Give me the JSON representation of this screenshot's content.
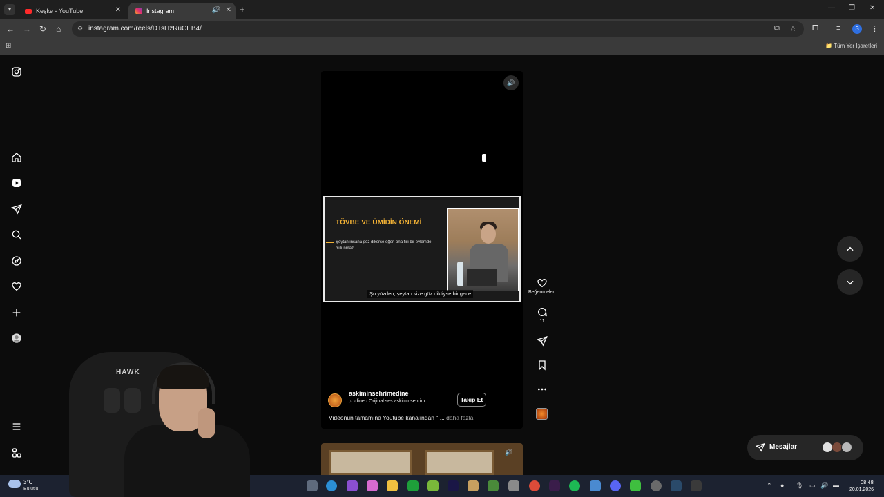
{
  "browser": {
    "tabs": [
      {
        "title": "Keşke - YouTube",
        "active": false
      },
      {
        "title": "Instagram",
        "active": true
      }
    ],
    "new_tab_label": "+",
    "url": "instagram.com/reels/DTsHzRuCEB4/",
    "bookmarks_all_label": "Tüm Yer İşaretleri",
    "profile_initial": "S"
  },
  "sidebar": {
    "items": [
      "instagram-logo",
      "home",
      "reels",
      "messages",
      "search",
      "explore",
      "notifications",
      "create",
      "profile",
      "more",
      "also-from-meta"
    ]
  },
  "reel": {
    "video_title": "TÖVBE VE ÜMİDİN ÖNEMİ",
    "video_text": "Şeytan insana göz dikerse eğer, ona fiili bir eylemde bulunmaz.",
    "subtitle": "Şu yüzden, şeytan size göz diktiyse bir gece",
    "author": "askiminsehrimedine",
    "audio": "♫ ·dine · Orijinal ses    askiminsehrim",
    "follow_label": "Takip Et",
    "caption": "Videonun tamamına Youtube kanalından \" ...",
    "caption_more": "daha fazla"
  },
  "actions": {
    "like_label": "Beğenmeler",
    "comment_count": "11"
  },
  "messages": {
    "label": "Mesajlar"
  },
  "webcam": {
    "chair_brand": "HAWK"
  },
  "taskbar": {
    "weather_temp": "3°C",
    "weather_desc": "Bulutlu",
    "time": "08:48",
    "date": "20.01.2026"
  },
  "colors": {
    "accent_title": "#f3b235",
    "page_bg": "#0c0c0c",
    "youtube_red": "#ff2a2a"
  }
}
